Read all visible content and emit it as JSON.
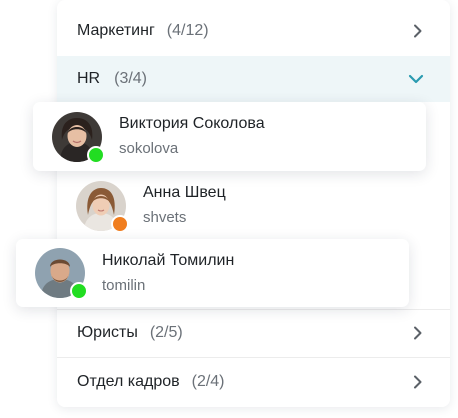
{
  "groups": [
    {
      "name": "Маркетинг",
      "count": "(4/12)"
    },
    {
      "name": "HR",
      "count": "(3/4)"
    },
    {
      "name": "Юристы",
      "count": "(2/5)"
    },
    {
      "name": "Отдел кадров",
      "count": "(2/4)"
    }
  ],
  "people": [
    {
      "name": "Виктория Соколова",
      "login": "sokolova",
      "status_color": "#22dd22"
    },
    {
      "name": "Анна Швец",
      "login": "shvets",
      "status_color": "#f07d1e"
    },
    {
      "name": "Николай Томилин",
      "login": "tomilin",
      "status_color": "#22dd22"
    }
  ],
  "icons": {
    "collapsed": "chevron-right-icon",
    "expanded": "chevron-down-icon"
  },
  "colors": {
    "accent": "#2a9bb0",
    "expanded_row_bg": "#eef6f8",
    "status_online": "#22dd22",
    "status_away": "#f07d1e"
  }
}
